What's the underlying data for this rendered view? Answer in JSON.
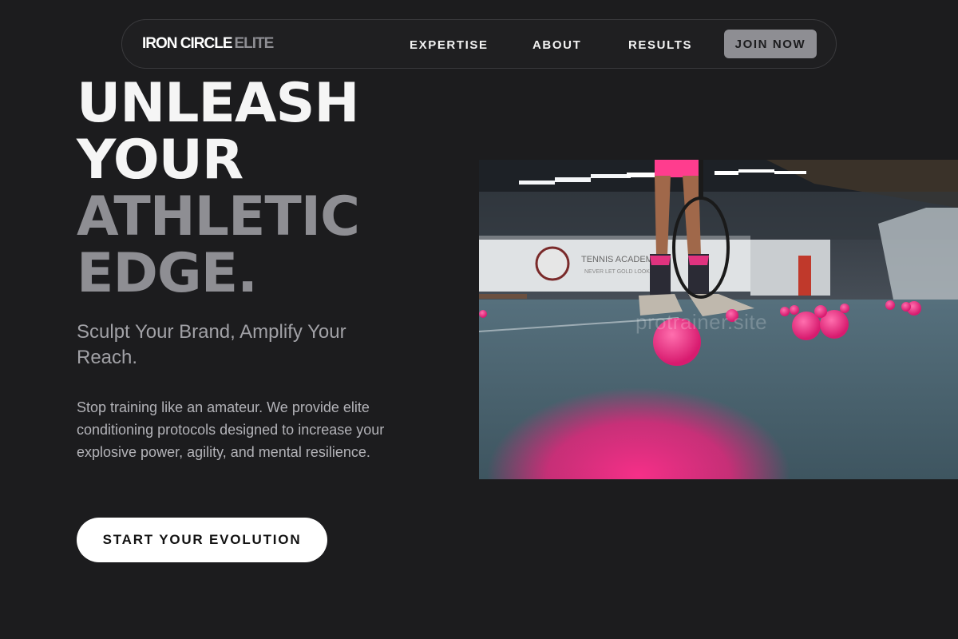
{
  "nav": {
    "logo_primary": "IRON CIRCLE",
    "logo_secondary": "ELITE",
    "links": [
      {
        "label": "EXPERTISE"
      },
      {
        "label": "ABOUT"
      },
      {
        "label": "RESULTS"
      }
    ],
    "cta_label": "JOIN NOW"
  },
  "hero": {
    "title_lines_light": [
      "UNLEASH",
      "YOUR"
    ],
    "title_lines_dim": [
      "ATHLETIC",
      "EDGE."
    ],
    "subtitle": "Sculpt Your Brand, Amplify Your Reach.",
    "body": "Stop training like an amateur. We provide elite conditioning protocols designed to increase your explosive power, agility, and mental resilience.",
    "cta_label": "START YOUR EVOLUTION"
  },
  "photo": {
    "watermark": "protrainer.site",
    "banner_text": "TENNIS ACADEMY",
    "banner_subtext": "NEVER LET GOLD LOOK"
  },
  "colors": {
    "background": "#1c1c1e",
    "accent_gray": "#8e8e93",
    "text_white": "#ffffff",
    "ball_pink": "#ff2d8a"
  }
}
